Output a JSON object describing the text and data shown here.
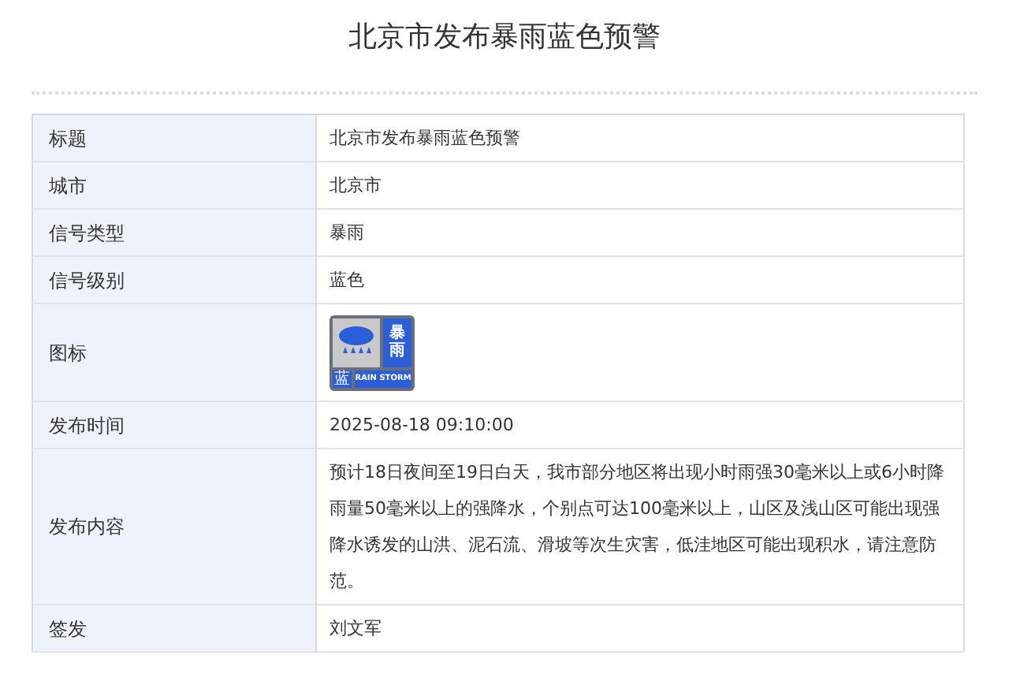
{
  "title": "北京市发布暴雨蓝色预警",
  "rows": [
    {
      "kind": "text",
      "label": "标题",
      "value": "北京市发布暴雨蓝色预警"
    },
    {
      "kind": "text",
      "label": "城市",
      "value": "北京市"
    },
    {
      "kind": "text",
      "label": "信号类型",
      "value": "暴雨"
    },
    {
      "kind": "text",
      "label": "信号级别",
      "value": "蓝色"
    },
    {
      "kind": "icon",
      "label": "图标",
      "icon": {
        "name": "暴雨",
        "english": "RAIN STORM",
        "level": "蓝"
      }
    },
    {
      "kind": "text",
      "label": "发布时间",
      "value": "2025-08-18 09:10:00"
    },
    {
      "kind": "text",
      "label": "发布内容",
      "value": "预计18日夜间至19日白天，我市部分地区将出现小时雨强30毫米以上或6小时降雨量50毫米以上的强降水，个别点可达100毫米以上，山区及浅山区可能出现强降水诱发的山洪、泥石流、滑坡等次生灾害，低洼地区可能出现积水，请注意防范。"
    },
    {
      "kind": "text",
      "label": "签发",
      "value": "刘文军"
    }
  ]
}
